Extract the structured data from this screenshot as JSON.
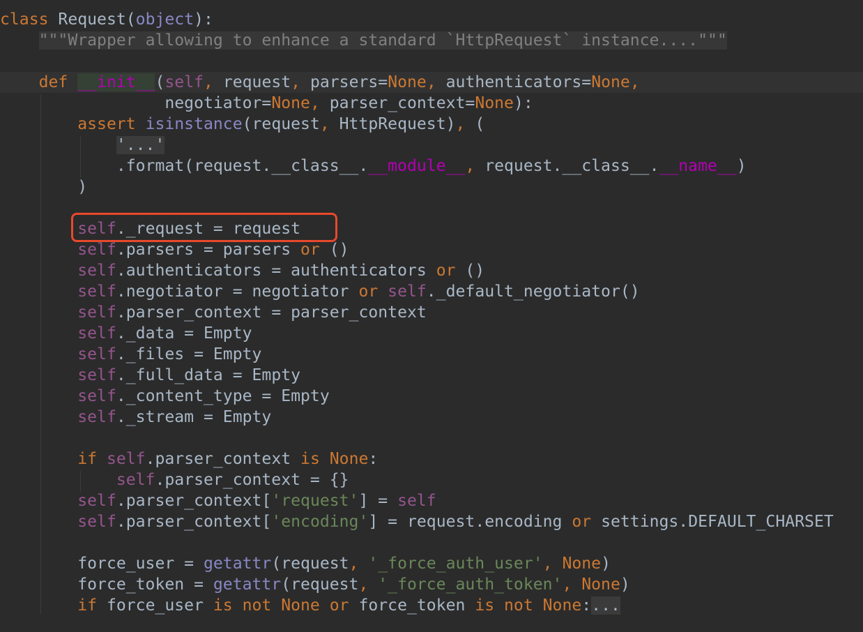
{
  "editor": {
    "language": "python",
    "current_line": 4,
    "highlight_box_color": "#e8492c",
    "lines": [
      [
        [
          "class",
          "kw"
        ],
        [
          " Request(",
          ""
        ],
        [
          "object",
          "bi"
        ],
        [
          "):",
          ""
        ]
      ],
      [
        [
          "    ",
          ""
        ],
        [
          "\"\"\"Wrapper allowing to enhance a standard `HttpRequest` instance....\"\"\"",
          "doc"
        ]
      ],
      [],
      [
        [
          "    ",
          ""
        ],
        [
          "def",
          "kw"
        ],
        [
          " ",
          ""
        ],
        [
          "__init__",
          "magic hl"
        ],
        [
          "(",
          ""
        ],
        [
          "self",
          "self"
        ],
        [
          ", ",
          "kw"
        ],
        [
          "request",
          ""
        ],
        [
          ", ",
          "kw"
        ],
        [
          "parsers=",
          ""
        ],
        [
          "None",
          "kw"
        ],
        [
          ", ",
          "kw"
        ],
        [
          "authenticators=",
          ""
        ],
        [
          "None",
          "kw"
        ],
        [
          ",",
          "kw"
        ]
      ],
      [
        [
          "                 negotiator=",
          ""
        ],
        [
          "None",
          "kw"
        ],
        [
          ", ",
          "kw"
        ],
        [
          "parser_context=",
          ""
        ],
        [
          "None",
          "kw"
        ],
        [
          "):",
          ""
        ]
      ],
      [
        [
          "        ",
          ""
        ],
        [
          "assert",
          "kw"
        ],
        [
          " ",
          ""
        ],
        [
          "isinstance",
          "bi"
        ],
        [
          "(request",
          ""
        ],
        [
          ", ",
          "kw"
        ],
        [
          "HttpRequest)",
          ""
        ],
        [
          ", ",
          "kw"
        ],
        [
          "(",
          ""
        ]
      ],
      [
        [
          "            ",
          ""
        ],
        [
          "'...'",
          "str fold"
        ]
      ],
      [
        [
          "            .format(request.__class__.",
          ""
        ],
        [
          "__module__",
          "magic"
        ],
        [
          ", ",
          "kw"
        ],
        [
          "request.__class__.",
          ""
        ],
        [
          "__name__",
          "magic"
        ],
        [
          ")",
          ""
        ]
      ],
      [
        [
          "        )",
          ""
        ]
      ],
      [],
      [
        [
          "        ",
          ""
        ],
        [
          "self",
          "self"
        ],
        [
          "._request = request",
          ""
        ]
      ],
      [
        [
          "        ",
          ""
        ],
        [
          "self",
          "self"
        ],
        [
          ".parsers = parsers ",
          ""
        ],
        [
          "or",
          "kw"
        ],
        [
          " ()",
          ""
        ]
      ],
      [
        [
          "        ",
          ""
        ],
        [
          "self",
          "self"
        ],
        [
          ".authenticators = authenticators ",
          ""
        ],
        [
          "or",
          "kw"
        ],
        [
          " ()",
          ""
        ]
      ],
      [
        [
          "        ",
          ""
        ],
        [
          "self",
          "self"
        ],
        [
          ".negotiator = negotiator ",
          ""
        ],
        [
          "or",
          "kw"
        ],
        [
          " ",
          ""
        ],
        [
          "self",
          "self"
        ],
        [
          "._default_negotiator()",
          ""
        ]
      ],
      [
        [
          "        ",
          ""
        ],
        [
          "self",
          "self"
        ],
        [
          ".parser_context = parser_context",
          ""
        ]
      ],
      [
        [
          "        ",
          ""
        ],
        [
          "self",
          "self"
        ],
        [
          "._data = Empty",
          ""
        ]
      ],
      [
        [
          "        ",
          ""
        ],
        [
          "self",
          "self"
        ],
        [
          "._files = Empty",
          ""
        ]
      ],
      [
        [
          "        ",
          ""
        ],
        [
          "self",
          "self"
        ],
        [
          "._full_data = Empty",
          ""
        ]
      ],
      [
        [
          "        ",
          ""
        ],
        [
          "self",
          "self"
        ],
        [
          "._content_type = Empty",
          ""
        ]
      ],
      [
        [
          "        ",
          ""
        ],
        [
          "self",
          "self"
        ],
        [
          "._stream = Empty",
          ""
        ]
      ],
      [],
      [
        [
          "        ",
          ""
        ],
        [
          "if",
          "kw"
        ],
        [
          " ",
          ""
        ],
        [
          "self",
          "self"
        ],
        [
          ".parser_context ",
          ""
        ],
        [
          "is",
          "kw"
        ],
        [
          " ",
          ""
        ],
        [
          "None",
          "kw"
        ],
        [
          ":",
          ""
        ]
      ],
      [
        [
          "            ",
          ""
        ],
        [
          "self",
          "self"
        ],
        [
          ".parser_context = {}",
          ""
        ]
      ],
      [
        [
          "        ",
          ""
        ],
        [
          "self",
          "self"
        ],
        [
          ".parser_context[",
          ""
        ],
        [
          "'request'",
          "str"
        ],
        [
          "] = ",
          ""
        ],
        [
          "self",
          "self"
        ]
      ],
      [
        [
          "        ",
          ""
        ],
        [
          "self",
          "self"
        ],
        [
          ".parser_context[",
          ""
        ],
        [
          "'encoding'",
          "str"
        ],
        [
          "] = request.encoding ",
          ""
        ],
        [
          "or",
          "kw"
        ],
        [
          " settings.DEFAULT_CHARSET",
          ""
        ]
      ],
      [],
      [
        [
          "        force_user = ",
          ""
        ],
        [
          "getattr",
          "bi"
        ],
        [
          "(request",
          ""
        ],
        [
          ", ",
          "kw"
        ],
        [
          "'_force_auth_user'",
          "str"
        ],
        [
          ", ",
          "kw"
        ],
        [
          "None",
          "kw"
        ],
        [
          ")",
          ""
        ]
      ],
      [
        [
          "        force_token = ",
          ""
        ],
        [
          "getattr",
          "bi"
        ],
        [
          "(request",
          ""
        ],
        [
          ", ",
          "kw"
        ],
        [
          "'_force_auth_token'",
          "str"
        ],
        [
          ", ",
          "kw"
        ],
        [
          "None",
          "kw"
        ],
        [
          ")",
          ""
        ]
      ],
      [
        [
          "        ",
          ""
        ],
        [
          "if",
          "kw"
        ],
        [
          " force_user ",
          ""
        ],
        [
          "is not",
          "kw"
        ],
        [
          " ",
          ""
        ],
        [
          "None",
          "kw"
        ],
        [
          " ",
          ""
        ],
        [
          "or",
          "kw"
        ],
        [
          " force_token ",
          ""
        ],
        [
          "is not",
          "kw"
        ],
        [
          " ",
          ""
        ],
        [
          "None",
          "kw"
        ],
        [
          ":",
          ""
        ],
        [
          "...",
          "fold"
        ]
      ]
    ]
  }
}
